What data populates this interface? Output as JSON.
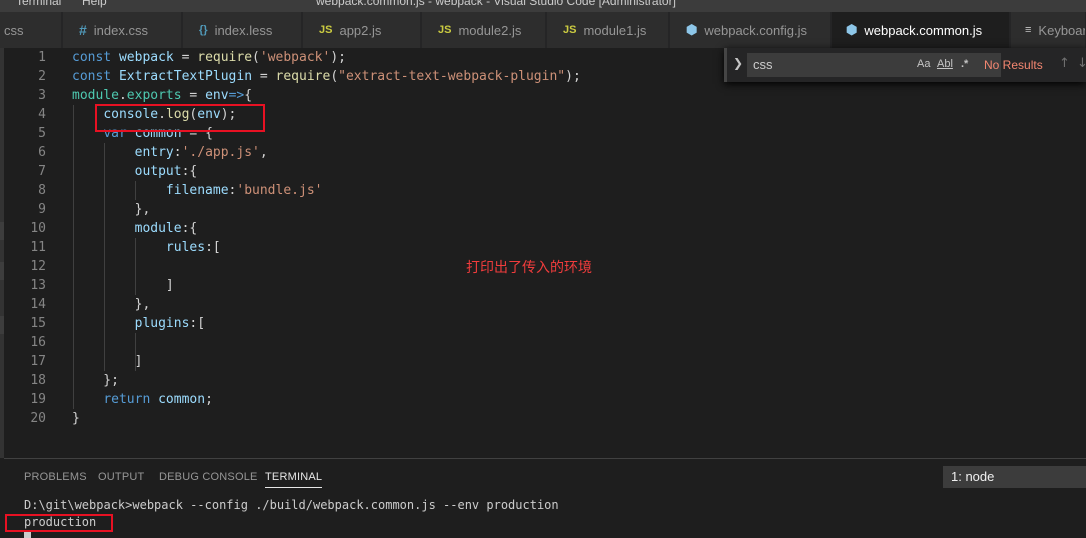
{
  "menubar": {
    "items": [
      "Terminal",
      "Help"
    ],
    "window_title": "webpack.common.js - webpack - Visual Studio Code [Administrator]"
  },
  "tabs": [
    {
      "label": "css",
      "icon": "",
      "active": false
    },
    {
      "label": "index.css",
      "icon": "#",
      "active": false
    },
    {
      "label": "index.less",
      "icon": "{}",
      "active": false
    },
    {
      "label": "app2.js",
      "icon": "JS",
      "active": false
    },
    {
      "label": "module2.js",
      "icon": "JS",
      "active": false
    },
    {
      "label": "module1.js",
      "icon": "JS",
      "active": false
    },
    {
      "label": "webpack.config.js",
      "icon": "cube",
      "active": false
    },
    {
      "label": "webpack.common.js",
      "icon": "cube",
      "active": true
    },
    {
      "label": "Keyboard",
      "icon": "lines",
      "active": false
    }
  ],
  "find": {
    "query": "css",
    "match_case": "Aa",
    "whole_word": "Abl",
    "regex": ".*",
    "status": "No Results",
    "prev": "↑",
    "next": "↓"
  },
  "editor": {
    "line_numbers": [
      "1",
      "2",
      "3",
      "4",
      "5",
      "6",
      "7",
      "8",
      "9",
      "10",
      "11",
      "12",
      "13",
      "14",
      "15",
      "16",
      "17",
      "18",
      "19",
      "20"
    ]
  },
  "annotation": {
    "note": "打印出了传入的环境"
  },
  "panel": {
    "tabs": [
      "PROBLEMS",
      "OUTPUT",
      "DEBUG CONSOLE",
      "TERMINAL"
    ],
    "active_tab": "TERMINAL",
    "terminal_selector": "1: node",
    "lines": [
      "D:\\git\\webpack>webpack --config ./build/webpack.common.js --env production",
      "production"
    ]
  },
  "colors": {
    "keyword": "#569cd6",
    "function": "#dcdcaa",
    "string": "#ce9178",
    "variable": "#9cdcfe",
    "annotation_red": "#e81123"
  }
}
